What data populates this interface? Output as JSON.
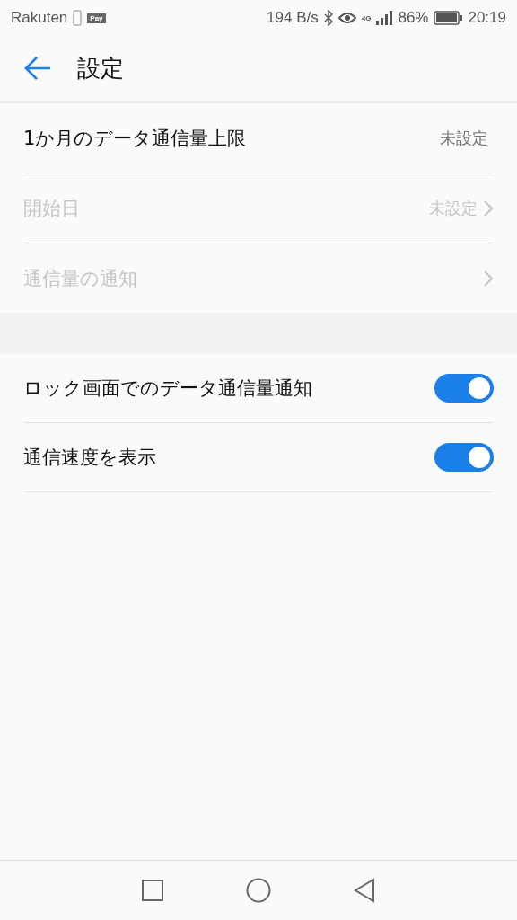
{
  "status_bar": {
    "carrier": "Rakuten",
    "pay_badge": "Pay",
    "speed": "194 B/s",
    "network": "4G",
    "battery": "86%",
    "time": "20:19"
  },
  "header": {
    "title": "設定"
  },
  "sections": [
    {
      "items": [
        {
          "kind": "value",
          "label": "1か月のデータ通信量上限",
          "value": "未設定",
          "disabled": false,
          "chevron": false
        },
        {
          "kind": "value",
          "label": "開始日",
          "value": "未設定",
          "disabled": true,
          "chevron": true
        },
        {
          "kind": "value",
          "label": "通信量の通知",
          "disabled": true,
          "chevron": true
        }
      ]
    },
    {
      "items": [
        {
          "kind": "toggle",
          "label": "ロック画面でのデータ通信量通知",
          "on": true
        },
        {
          "kind": "toggle",
          "label": "通信速度を表示",
          "on": true
        }
      ]
    }
  ]
}
